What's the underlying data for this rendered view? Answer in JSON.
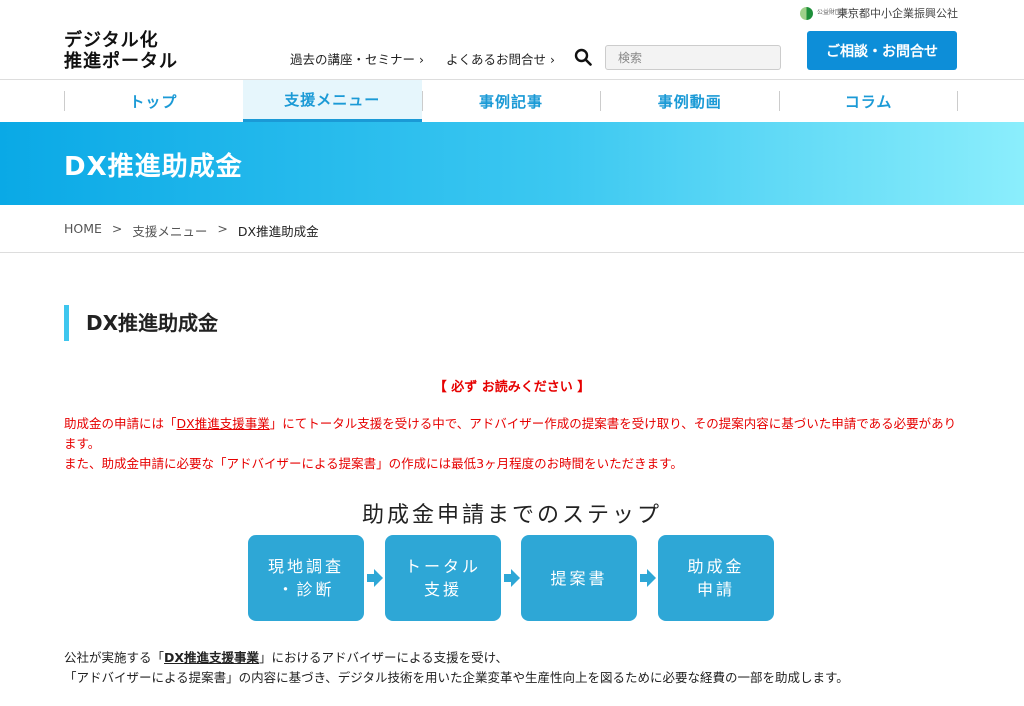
{
  "header": {
    "org_prefix": "公益財団法人",
    "org_name": "東京都中小企業振興公社",
    "logo_line1": "デジタル化",
    "logo_line2": "推進ポータル",
    "nav": [
      {
        "label": "過去の講座・セミナー",
        "chevron": "›"
      },
      {
        "label": "よくあるお問合せ",
        "chevron": "›"
      }
    ],
    "search_placeholder": "検索",
    "contact_label": "ご相談・お問合せ"
  },
  "main_nav": {
    "tabs": [
      {
        "label": "トップ"
      },
      {
        "label": "支援メニュー"
      },
      {
        "label": "事例記事"
      },
      {
        "label": "事例動画"
      },
      {
        "label": "コラム"
      }
    ],
    "active_index": 1
  },
  "hero": {
    "title": "DX推進助成金"
  },
  "breadcrumb": {
    "items": [
      "HOME",
      "支援メニュー",
      "DX推進助成金"
    ],
    "separator": ">"
  },
  "content": {
    "section_title": "DX推進助成金",
    "notice_heading": "【 必ず お読みください 】",
    "notice": {
      "p1_before": "助成金の申請には「",
      "p1_link": "DX推進支援事業",
      "p1_after": "」にてトータル支援を受ける中で、アドバイザー作成の提案書を受け取り、その提案内容に基づいた申請である必要があります。",
      "p2": "また、助成金申請に必要な「アドバイザーによる提案書」の作成には最低3ヶ月程度のお時間をいただきます。"
    },
    "steps_title": "助成金申請までのステップ",
    "steps": [
      {
        "line1": "現地調査",
        "line2": "・診断"
      },
      {
        "line1": "トータル",
        "line2": "支援"
      },
      {
        "line1": "提案書",
        "line2": ""
      },
      {
        "line1": "助成金",
        "line2": "申請"
      }
    ],
    "body": {
      "p1_before": "公社が実施する「",
      "p1_link": "DX推進支援事業",
      "p1_after": "」におけるアドバイザーによる支援を受け、",
      "p2": "「アドバイザーによる提案書」の内容に基づき、デジタル技術を用いた企業変革や生産性向上を図るために必要な経費の一部を助成します。"
    }
  },
  "colors": {
    "accent": "#1b9ad6",
    "button": "#0d8ed8",
    "step": "#2ea7d6",
    "notice": "#e60000"
  }
}
